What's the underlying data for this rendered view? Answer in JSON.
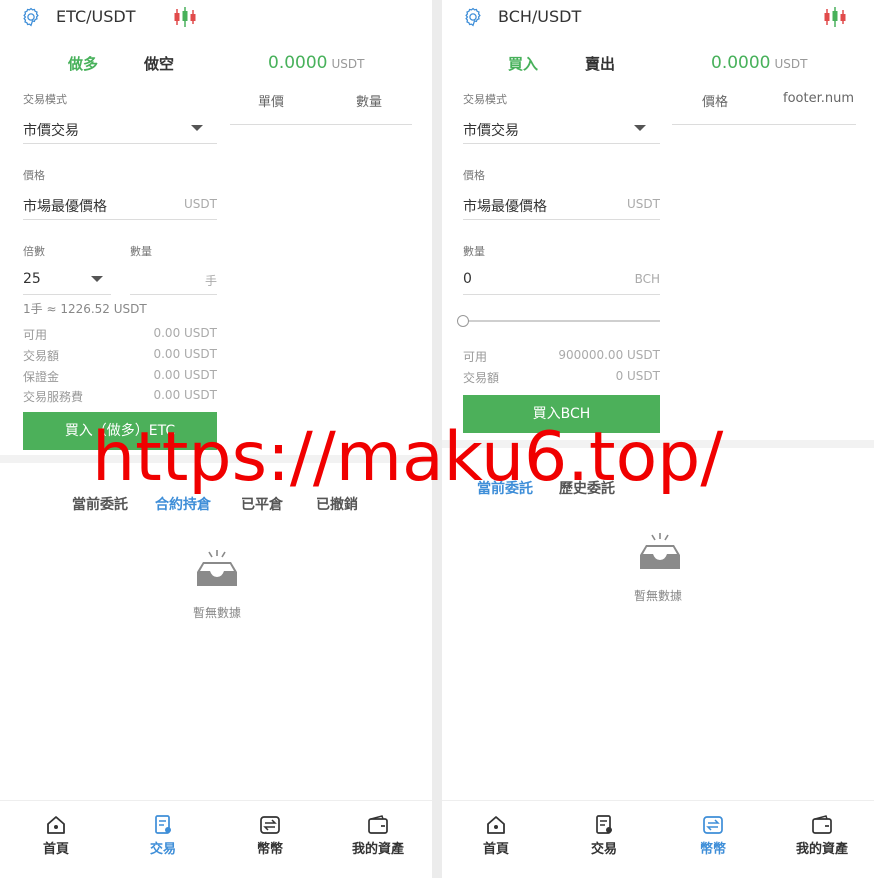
{
  "watermark": "https://maku6.top/",
  "colors": {
    "accent_green": "#4cb05a",
    "accent_blue": "#3e8ed8",
    "watermark_red": "#f00000"
  },
  "left": {
    "pair": "ETC/USDT",
    "tabs": {
      "long": "做多",
      "short": "做空"
    },
    "price": "0.0000",
    "price_unit": "USDT",
    "orderbook_headers": [
      "單價",
      "數量"
    ],
    "mode_label": "交易模式",
    "mode_value": "市價交易",
    "price_label": "價格",
    "price_value": "市場最優價格",
    "price_field_unit": "USDT",
    "multiplier_label": "倍數",
    "qty_label": "數量",
    "multiplier_value": "25",
    "qty_unit": "手",
    "lot_note": "1手 ≈ 1226.52 USDT",
    "info": [
      {
        "k": "可用",
        "v": "0.00 USDT"
      },
      {
        "k": "交易額",
        "v": "0.00 USDT"
      },
      {
        "k": "保證金",
        "v": "0.00 USDT"
      },
      {
        "k": "交易服務費",
        "v": "0.00 USDT"
      }
    ],
    "buy_button": "買入（做多）ETC",
    "order_tabs": [
      "當前委託",
      "合約持倉",
      "已平倉",
      "已撤銷"
    ],
    "empty_text": "暫無數據"
  },
  "right": {
    "pair": "BCH/USDT",
    "tabs": {
      "buy": "買入",
      "sell": "賣出"
    },
    "price": "0.0000",
    "price_unit": "USDT",
    "orderbook_headers": [
      "價格",
      "footer.num"
    ],
    "mode_label": "交易模式",
    "mode_value": "市價交易",
    "price_label": "價格",
    "price_value": "市場最優價格",
    "price_field_unit": "USDT",
    "qty_label": "數量",
    "qty_value": "0",
    "qty_unit": "BCH",
    "slider_percent": 0,
    "info": [
      {
        "k": "可用",
        "v": "900000.00 USDT"
      },
      {
        "k": "交易額",
        "v": "0 USDT"
      }
    ],
    "buy_button": "買入BCH",
    "order_tabs": [
      "當前委託",
      "歷史委託"
    ],
    "empty_text": "暫無數據"
  },
  "nav": {
    "items": [
      {
        "label": "首頁",
        "icon": "home-icon"
      },
      {
        "label": "交易",
        "icon": "trade-icon"
      },
      {
        "label": "幣幣",
        "icon": "coin-swap-icon"
      },
      {
        "label": "我的資產",
        "icon": "wallet-icon"
      }
    ]
  }
}
